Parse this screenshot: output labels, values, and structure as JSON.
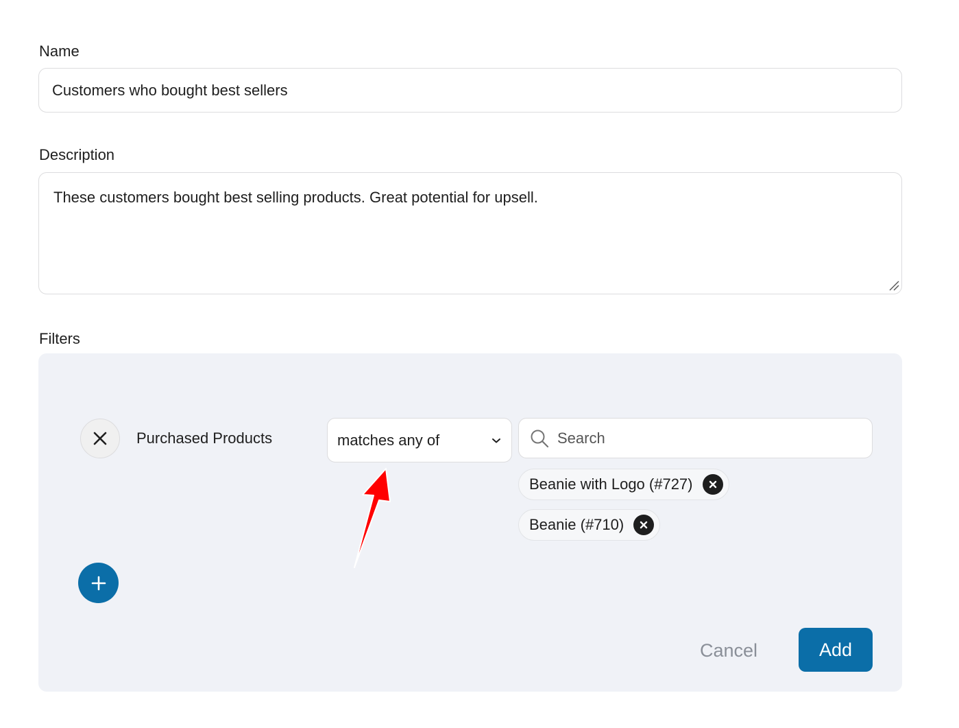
{
  "form": {
    "name_label": "Name",
    "name_value": "Customers who bought best sellers",
    "description_label": "Description",
    "description_value": "These customers bought best selling products. Great potential for upsell.",
    "filters_label": "Filters"
  },
  "filter": {
    "name": "Purchased Products",
    "operator": "matches any of",
    "search_placeholder": "Search",
    "selected": [
      {
        "label": "Beanie with Logo (#727)"
      },
      {
        "label": "Beanie (#710)"
      }
    ]
  },
  "actions": {
    "cancel_label": "Cancel",
    "add_label": "Add"
  },
  "colors": {
    "primary": "#0b6ea8",
    "panel_bg": "#f0f2f7",
    "annotation_arrow": "#ff0000"
  }
}
